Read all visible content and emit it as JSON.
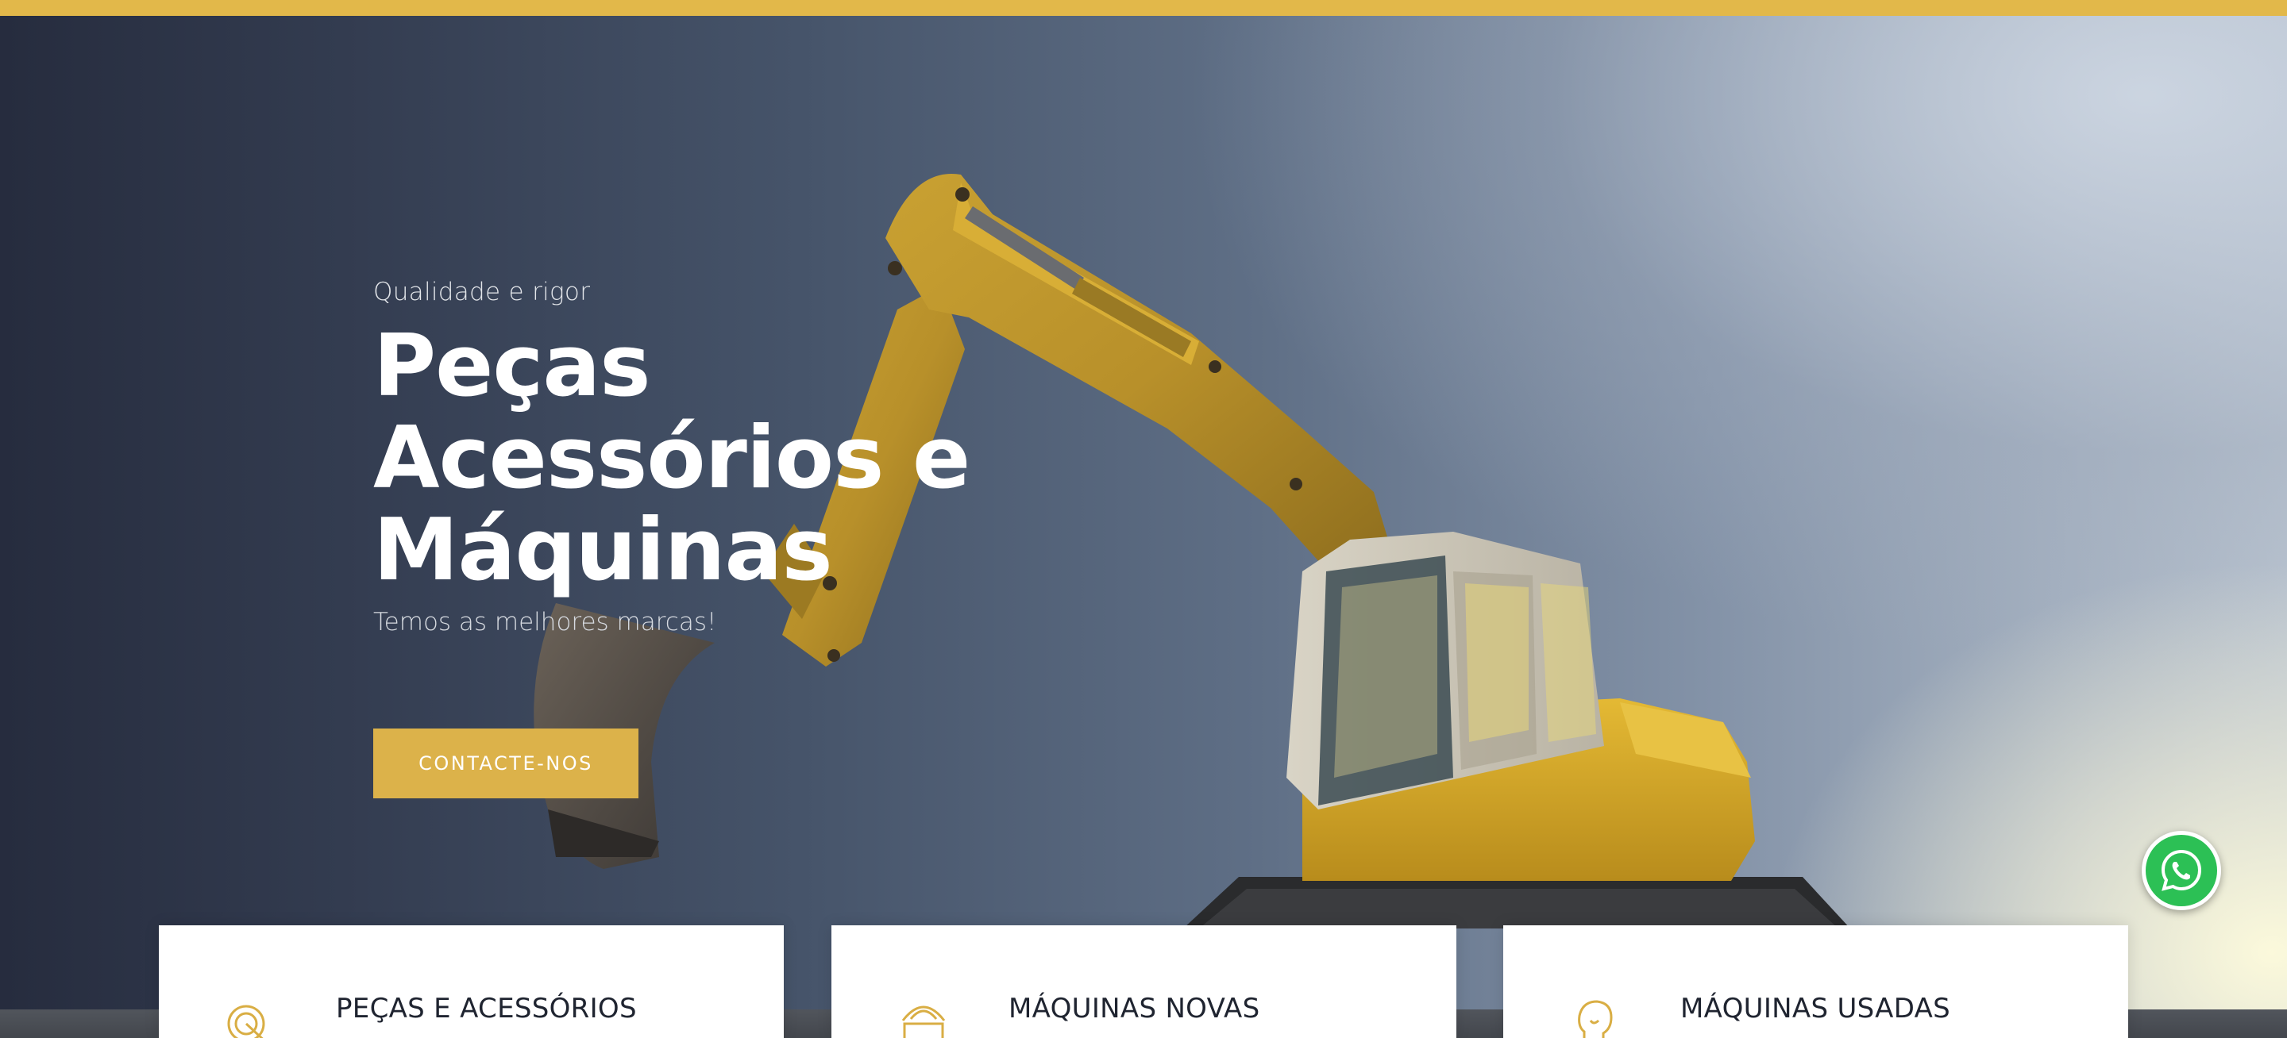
{
  "hero": {
    "eyebrow": "Qualidade e rigor",
    "headline_lines": [
      "Peças",
      "Acessórios e",
      "Máquinas"
    ],
    "subline": "Temos as melhores marcas!",
    "cta_label": "CONTACTE-NOS"
  },
  "cards": [
    {
      "title": "PEÇAS E ACESSÓRIOS",
      "icon": "touch-pointer-icon"
    },
    {
      "title": "MÁQUINAS NOVAS",
      "icon": "shopping-bag-icon"
    },
    {
      "title": "MÁQUINAS USADAS",
      "icon": "user-profile-icon"
    }
  ],
  "floating": {
    "icon": "whatsapp-icon"
  },
  "colors": {
    "accent": "#dcb24a",
    "top_bar": "#e2b84a",
    "whatsapp_green": "#2cc055",
    "card_title": "#1f2430"
  }
}
